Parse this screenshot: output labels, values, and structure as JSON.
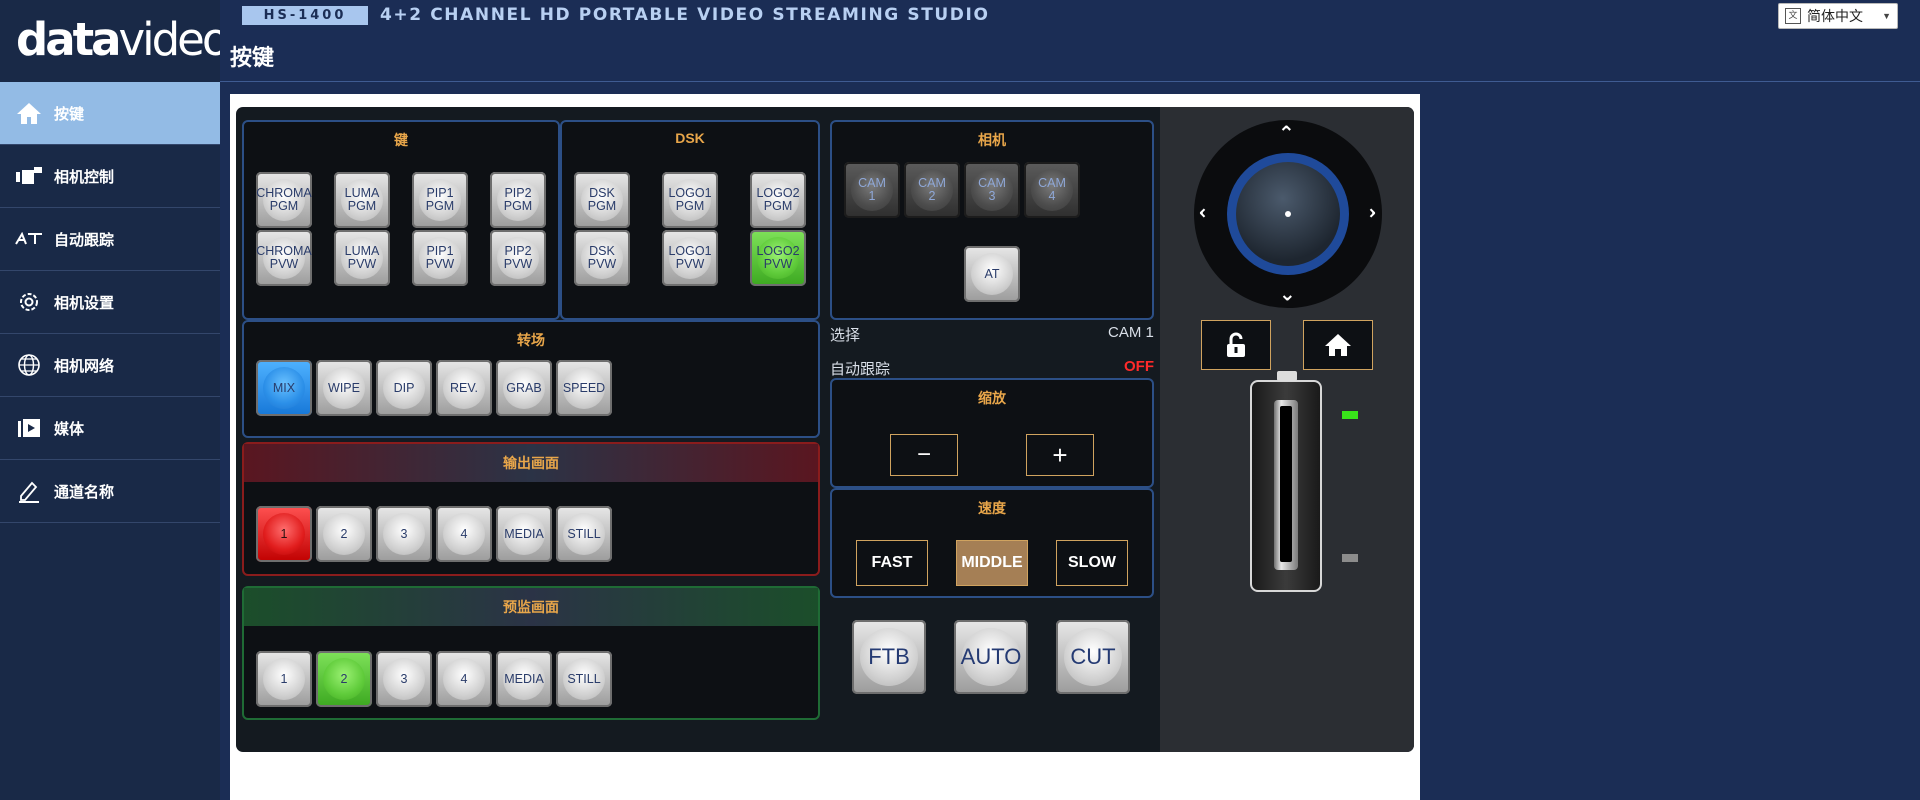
{
  "brand": {
    "logo_bold": "data",
    "logo_thin": "video"
  },
  "header": {
    "model": "HS-1400",
    "product_title": "4+2 CHANNEL HD PORTABLE VIDEO STREAMING STUDIO",
    "page_title": "按键",
    "language": "简体中文"
  },
  "sidebar": {
    "items": [
      {
        "label": "按键",
        "icon": "home-icon",
        "active": true
      },
      {
        "label": "相机控制",
        "icon": "camera-control-icon"
      },
      {
        "label": "自动跟踪",
        "icon": "auto-tracking-icon"
      },
      {
        "label": "相机设置",
        "icon": "gear-icon"
      },
      {
        "label": "相机网络",
        "icon": "globe-icon"
      },
      {
        "label": "媒体",
        "icon": "media-icon"
      },
      {
        "label": "通道名称",
        "icon": "edit-icon"
      }
    ]
  },
  "key_section": {
    "title": "键",
    "buttons": [
      "CHROMA\nPGM",
      "LUMA\nPGM",
      "PIP1\nPGM",
      "PIP2\nPGM",
      "CHROMA\nPVW",
      "LUMA\nPVW",
      "PIP1\nPVW",
      "PIP2\nPVW"
    ]
  },
  "dsk_section": {
    "title": "DSK",
    "buttons": [
      "DSK\nPGM",
      "LOGO1\nPGM",
      "LOGO2\nPGM",
      "DSK\nPVW",
      "LOGO1\nPVW",
      "LOGO2\nPVW"
    ],
    "active": "LOGO2 PVW"
  },
  "transition_section": {
    "title": "转场",
    "buttons": [
      "MIX",
      "WIPE",
      "DIP",
      "REV.",
      "GRAB",
      "SPEED"
    ],
    "active": "MIX"
  },
  "program_section": {
    "title": "输出画面",
    "buttons": [
      "1",
      "2",
      "3",
      "4",
      "MEDIA",
      "STILL"
    ],
    "active": "1"
  },
  "preview_section": {
    "title": "预监画面",
    "buttons": [
      "1",
      "2",
      "3",
      "4",
      "MEDIA",
      "STILL"
    ],
    "active": "2"
  },
  "camera_section": {
    "title": "相机",
    "buttons": [
      "CAM\n1",
      "CAM\n2",
      "CAM\n3",
      "CAM\n4"
    ],
    "at_button": "AT"
  },
  "status": {
    "select_label": "选择",
    "select_value": "CAM 1",
    "autotrack_label": "自动跟踪",
    "autotrack_value": "OFF"
  },
  "zoom_section": {
    "title": "缩放",
    "minus": "−",
    "plus": "+"
  },
  "speed_section": {
    "title": "速度",
    "buttons": [
      "FAST",
      "MIDDLE",
      "SLOW"
    ],
    "active": "MIDDLE"
  },
  "main_buttons": [
    "FTB",
    "AUTO",
    "CUT"
  ],
  "colors": {
    "accent_orange": "#e8a64a",
    "active_green": "#5fcb3a",
    "program_red": "#e11d1d",
    "mix_blue": "#2b8fe8",
    "speed_selected": "#a57f55"
  }
}
